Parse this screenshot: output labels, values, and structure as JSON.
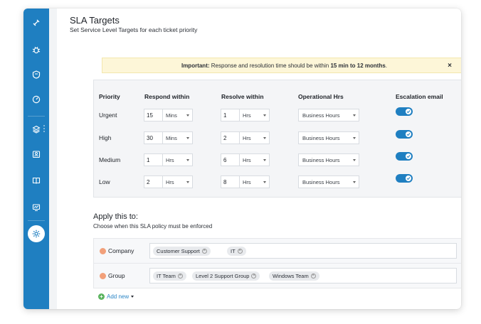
{
  "colors": {
    "sidebar": "#1f7fc1",
    "alert_bg": "#fdf6d8",
    "toggle_on": "#1f7fc1",
    "remove_dot": "#f2a07a",
    "add_dot": "#5bb45f"
  },
  "sidebar": {
    "items": [
      {
        "icon": "ticket-icon"
      },
      {
        "icon": "bug-icon"
      },
      {
        "icon": "shield-icon"
      },
      {
        "icon": "gauge-icon"
      },
      {
        "icon": "layers-icon"
      },
      {
        "icon": "user-badge-icon"
      },
      {
        "icon": "book-icon"
      },
      {
        "icon": "monitor-icon"
      },
      {
        "icon": "gear-icon",
        "active": true
      }
    ]
  },
  "header": {
    "title": "SLA Targets",
    "subtitle": "Set Service Level Targets for each ticket priority"
  },
  "alert": {
    "prefix": "Important:",
    "message": "Response and resolution time should be within",
    "range": "15 min to 12 months",
    "suffix": ".",
    "close": "×"
  },
  "table": {
    "headers": [
      "Priority",
      "Respond within",
      "Resolve within",
      "Operational Hrs",
      "Escalation email"
    ],
    "rows": [
      {
        "priority": "Urgent",
        "respond_value": "15",
        "respond_unit": "Mins",
        "resolve_value": "1",
        "resolve_unit": "Hrs",
        "hours": "Business Hours",
        "escalation": true
      },
      {
        "priority": "High",
        "respond_value": "30",
        "respond_unit": "Mins",
        "resolve_value": "2",
        "resolve_unit": "Hrs",
        "hours": "Business Hours",
        "escalation": true
      },
      {
        "priority": "Medium",
        "respond_value": "1",
        "respond_unit": "Hrs",
        "resolve_value": "6",
        "resolve_unit": "Hrs",
        "hours": "Business Hours",
        "escalation": true
      },
      {
        "priority": "Low",
        "respond_value": "2",
        "respond_unit": "Hrs",
        "resolve_value": "8",
        "resolve_unit": "Hrs",
        "hours": "Business Hours",
        "escalation": true
      }
    ]
  },
  "apply": {
    "title": "Apply this to:",
    "subtitle": "Choose when this SLA policy must be enforced",
    "conditions": [
      {
        "name": "Company",
        "tags": [
          "Customer Support",
          "IT"
        ]
      },
      {
        "name": "Group",
        "tags": [
          "IT Team",
          "Level 2 Support Group",
          "Windows Team"
        ]
      }
    ],
    "add_new": "Add new"
  }
}
